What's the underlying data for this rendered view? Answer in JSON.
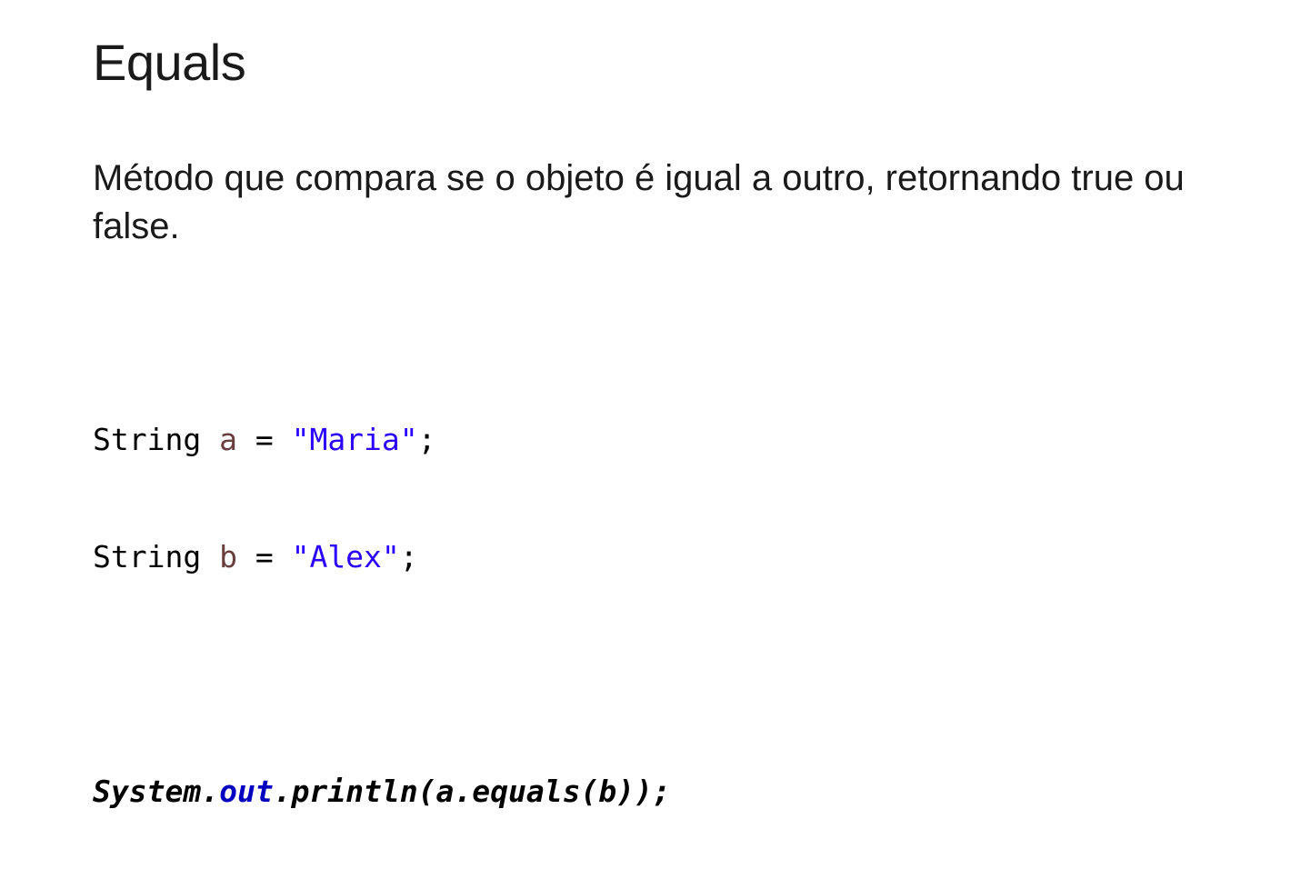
{
  "slide": {
    "title": "Equals",
    "body": "Método que compara se o objeto é igual a outro, retornando true ou false."
  },
  "code": {
    "line1": {
      "type": "String",
      "var": "a",
      "op": " = ",
      "value": "\"Maria\"",
      "end": ";"
    },
    "line2": {
      "type": "String",
      "var": "b",
      "op": " = ",
      "value": "\"Alex\"",
      "end": ";"
    },
    "line3": {
      "prefix": "System.",
      "field": "out",
      "suffix": ".println(a.equals(b));"
    }
  },
  "colors": {
    "text": "#1a1a1a",
    "variable": "#6a3e3e",
    "string": "#2a00ff",
    "static_field": "#0000c0"
  }
}
